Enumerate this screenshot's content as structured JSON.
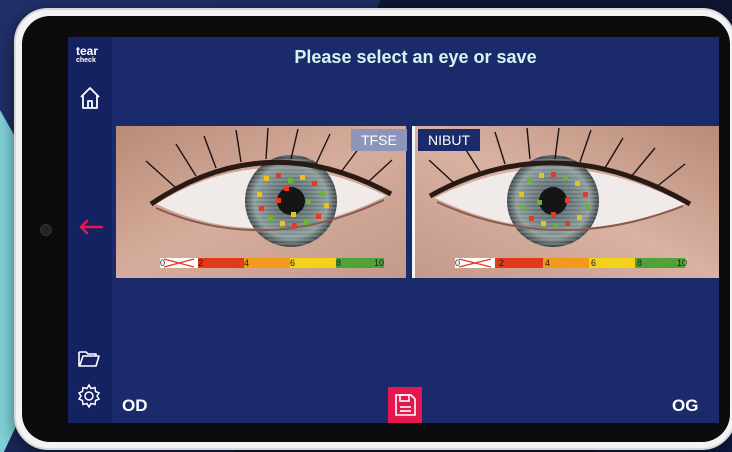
{
  "app": {
    "logo_line1": "tear",
    "logo_line2": "check"
  },
  "header": {
    "title": "Please select an eye or save"
  },
  "tabs": [
    {
      "label": "TFSE",
      "active": false
    },
    {
      "label": "NIBUT",
      "active": true
    }
  ],
  "scale": {
    "ticks": [
      "0",
      "2",
      "4",
      "6",
      "8",
      "10"
    ]
  },
  "footer": {
    "left_eye_label": "OD",
    "right_eye_label": "OG"
  },
  "sidebar": {
    "icons": [
      "home-icon",
      "back-arrow-icon",
      "folder-icon",
      "settings-icon"
    ]
  },
  "colors": {
    "accent": "#e3184f",
    "screen_bg": "#1b2a6b",
    "title_text": "#d8f4f1"
  }
}
